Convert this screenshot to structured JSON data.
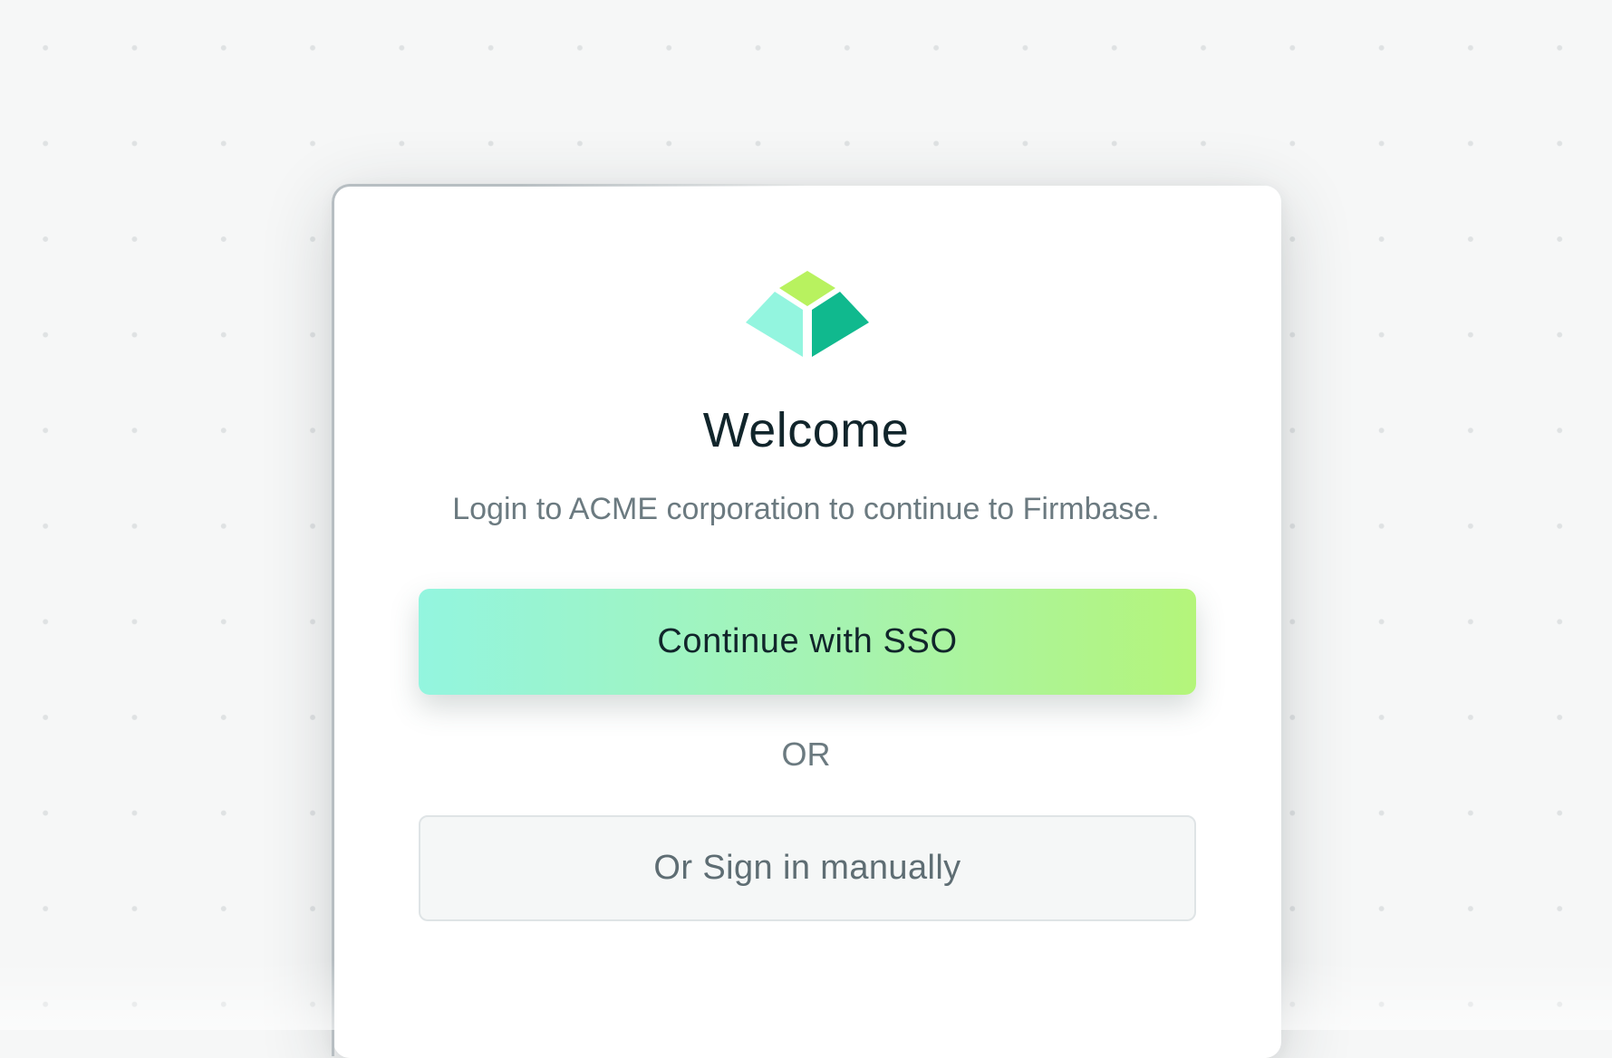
{
  "logo": {
    "icon": "firmbase-cube-logo-icon",
    "colors": {
      "top": "#b8f25f",
      "left": "#93f5df",
      "right": "#10b98e"
    }
  },
  "login": {
    "title": "Welcome",
    "subtitle": "Login to ACME corporation to continue to Firmbase.",
    "sso_button_label": "Continue with SSO",
    "divider_label": "OR",
    "manual_button_label": "Or Sign in manually"
  },
  "colors": {
    "background": "#f6f7f7",
    "card": "#ffffff",
    "heading_text": "#11252b",
    "muted_text": "#6b7a80",
    "sso_gradient_start": "#93f5df",
    "sso_gradient_end": "#b4f57a",
    "manual_button_bg": "#f5f7f7",
    "manual_button_border": "#dfe4e6"
  }
}
